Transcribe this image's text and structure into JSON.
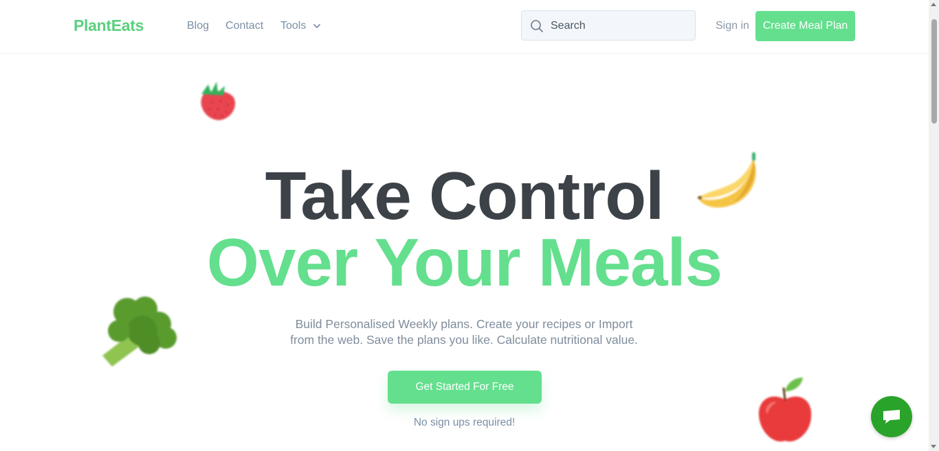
{
  "header": {
    "logo": "PlantEats",
    "nav": {
      "blog": "Blog",
      "contact": "Contact",
      "tools": "Tools"
    },
    "search": {
      "placeholder": "Search"
    },
    "signin": "Sign in",
    "create_meal_plan": "Create Meal Plan"
  },
  "hero": {
    "line1": "Take Control",
    "line2": "Over Your Meals",
    "description_line1": "Build Personalised Weekly plans. Create your recipes or Import",
    "description_line2": "from the web. Save the plans you like. Calculate nutritional value.",
    "cta": "Get Started For Free",
    "note": "No sign ups required!"
  },
  "icons": {
    "decorations": [
      "strawberry-icon",
      "banana-icon",
      "broccoli-icon",
      "apple-icon"
    ],
    "chat": "chat-icon",
    "search": "search-icon",
    "tools_dropdown": "chevron-down-icon"
  },
  "colors": {
    "brand_green": "#64df8e",
    "heading_dark": "#3c4247",
    "nav_text": "#7b8fa6",
    "chat_green": "#2aa32a"
  }
}
